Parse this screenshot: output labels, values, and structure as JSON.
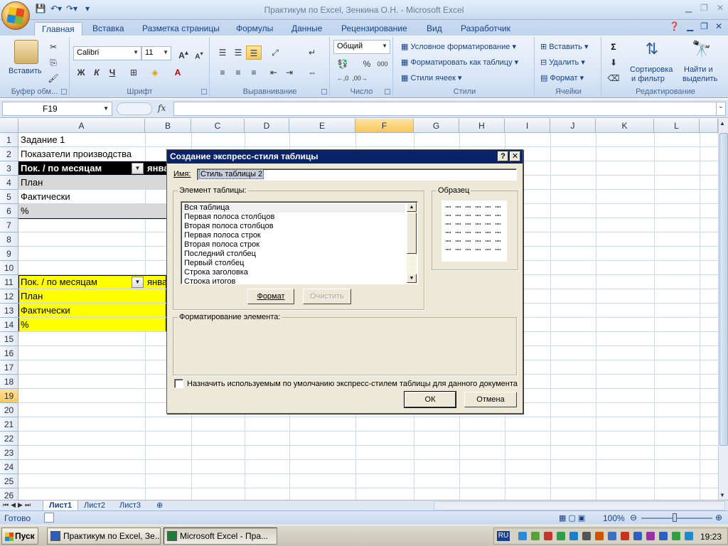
{
  "window": {
    "title": "Практикум по Excel, Зенкина О.Н. - Microsoft Excel"
  },
  "ribbon": {
    "tabs": [
      "Главная",
      "Вставка",
      "Разметка страницы",
      "Формулы",
      "Данные",
      "Рецензирование",
      "Вид",
      "Разработчик"
    ],
    "clipboard": {
      "paste": "Вставить",
      "label": "Буфер обм..."
    },
    "font": {
      "name": "Calibri",
      "size": "11",
      "bold": "Ж",
      "italic": "К",
      "underline": "Ч",
      "label": "Шрифт"
    },
    "alignment": {
      "label": "Выравнивание"
    },
    "number": {
      "format": "Общий",
      "label": "Число",
      "percent": "%",
      "thousands": "000"
    },
    "styles": {
      "conditional": "Условное форматирование",
      "as_table": "Форматировать как таблицу",
      "cell_styles": "Стили ячеек",
      "label": "Стили"
    },
    "cells": {
      "insert": "Вставить",
      "delete": "Удалить",
      "format": "Формат",
      "label": "Ячейки"
    },
    "editing": {
      "sigma": "Σ",
      "sort_line1": "Сортировка",
      "sort_line2": "и фильтр",
      "find_line1": "Найти и",
      "find_line2": "выделить",
      "label": "Редактирование"
    }
  },
  "formula_bar": {
    "name_box": "F19",
    "fx": "fx",
    "value": ""
  },
  "grid": {
    "columns": [
      "A",
      "B",
      "C",
      "D",
      "E",
      "F",
      "G",
      "H",
      "I",
      "J",
      "K",
      "L"
    ],
    "selected_column": "F",
    "rows": [
      "1",
      "2",
      "3",
      "4",
      "5",
      "6",
      "7",
      "8",
      "9",
      "10",
      "11",
      "12",
      "13",
      "14",
      "15",
      "16",
      "17",
      "18",
      "19",
      "20",
      "21",
      "22",
      "23",
      "24",
      "25",
      "26"
    ],
    "selected_row": "19",
    "cells": {
      "A1": "Задание 1",
      "A2": "Показатели производства",
      "A3": "Пок. / по месяцам",
      "B3": "янва",
      "A4": "План",
      "A5": "Фактически",
      "A6": "%",
      "A11": "Пок. / по месяцам",
      "B11": "янва",
      "A12": "План",
      "A13": "Фактически",
      "A14": "%"
    },
    "colors": {
      "yellow": "#ffff00",
      "black_header": "#000000",
      "gray_band": "#d8d8d8"
    }
  },
  "sheets": {
    "tabs": [
      "Лист1",
      "Лист2",
      "Лист3"
    ],
    "active": "Лист1"
  },
  "status": {
    "ready": "Готово",
    "zoom": "100%"
  },
  "dialog": {
    "title": "Создание экспресс-стиля таблицы",
    "help": "?",
    "close": "✕",
    "name_label": "Имя:",
    "name_value": "Стиль таблицы 2",
    "element_legend": "Элемент таблицы:",
    "elements": [
      "Вся таблица",
      "Первая полоса столбцов",
      "Вторая полоса столбцов",
      "Первая полоса строк",
      "Вторая полоса строк",
      "Последний столбец",
      "Первый столбец",
      "Строка заголовка",
      "Строка итогов"
    ],
    "preview_legend": "Образец",
    "format_button": "Формат",
    "clear_button": "Очистить",
    "element_format_legend": "Форматирование элемента:",
    "default_checkbox": "Назначить используемым по умолчанию экспресс-стилем таблицы для данного документа",
    "ok": "ОК",
    "cancel": "Отмена"
  },
  "taskbar": {
    "start": "Пуск",
    "tasks": [
      "Практикум по Excel, Зе...",
      "Microsoft Excel - Пра..."
    ],
    "lang": "RU",
    "clock": "19:23"
  }
}
